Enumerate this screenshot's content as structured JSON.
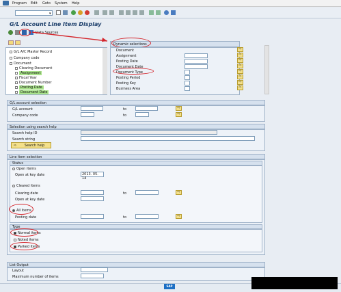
{
  "menu": [
    "Program",
    "Edit",
    "Goto",
    "System",
    "Help"
  ],
  "title": "G/L Account Line Item Display",
  "toolbar2": {
    "data_sources": "Data Sources"
  },
  "tree": {
    "items": [
      {
        "label": "G/L A/C Master Record",
        "green": false
      },
      {
        "label": "Company code",
        "green": false
      },
      {
        "label": "Document",
        "green": false
      },
      {
        "label": "Clearing Document",
        "green": false
      },
      {
        "label": "Assignment",
        "green": true
      },
      {
        "label": "Fiscal Year",
        "green": false
      },
      {
        "label": "Document Number",
        "green": false
      },
      {
        "label": "Posting Date",
        "green": true
      },
      {
        "label": "Document Date",
        "green": true
      }
    ]
  },
  "dynsel": {
    "header": "Dynamic selections",
    "rows": [
      "Document",
      "Assignment",
      "Posting Date",
      "Document Date",
      "Document Type",
      "Posting Period",
      "Posting Key",
      "Business Area"
    ]
  },
  "glsel": {
    "header": "G/L account selection",
    "gl_account": "G/L account",
    "company_code": "Company code",
    "to": "to"
  },
  "search": {
    "header": "Selection using search help",
    "search_help_id": "Search help ID",
    "search_string": "Search string",
    "button": "Search help"
  },
  "lineitem": {
    "header": "Line item selection",
    "status": "Status",
    "open_items": "Open items",
    "open_key_date_label": "Open at key date",
    "open_key_date": "2013. 05. 14",
    "cleared_items": "Cleared items",
    "clearing_date": "Clearing date",
    "open_at_key_date2": "Open at key date",
    "all_items": "All items",
    "posting_date": "Posting date",
    "to": "to",
    "type": "Type",
    "normal_items": "Normal items",
    "noted_items": "Noted items",
    "parked_items": "Parked items"
  },
  "output": {
    "header": "List Output",
    "layout": "Layout",
    "max_items": "Maximum number of items"
  },
  "footer": {
    "logo": "SAP"
  },
  "colors": {
    "accent": "#d4252b",
    "panel": "#edf2f8",
    "header": "#d6e1ee",
    "green": "#a9e38a"
  }
}
